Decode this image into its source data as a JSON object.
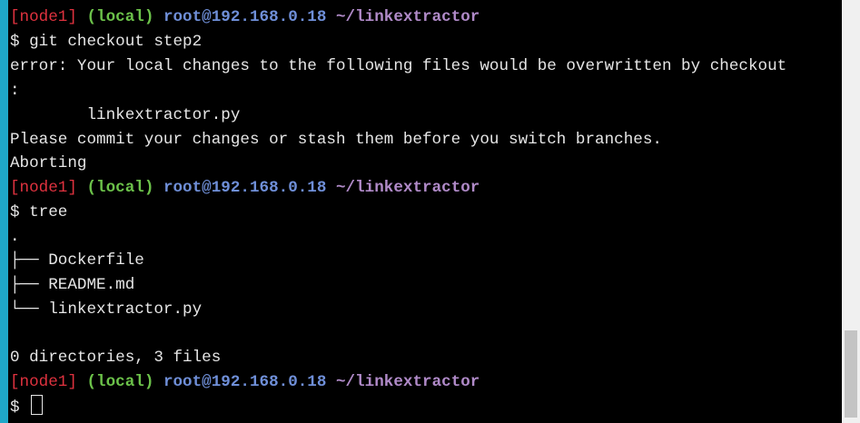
{
  "prompt_1": {
    "node": "[node1]",
    "local": "(local)",
    "user": "root@192.168.0.18",
    "path": "~/linkextractor"
  },
  "cmd_1": "$ git checkout step2",
  "error_line_1": "error: Your local changes to the following files would be overwritten by checkout",
  "error_line_2": ":",
  "error_file": "        linkextractor.py",
  "please_commit": "Please commit your changes or stash them before you switch branches.",
  "aborting": "Aborting",
  "prompt_2": {
    "node": "[node1]",
    "local": "(local)",
    "user": "root@192.168.0.18",
    "path": "~/linkextractor"
  },
  "cmd_2": "$ tree",
  "tree": {
    "root": ".",
    "entries": [
      "├── Dockerfile",
      "├── README.md",
      "└── linkextractor.py"
    ],
    "summary": "0 directories, 3 files"
  },
  "prompt_3": {
    "node": "[node1]",
    "local": "(local)",
    "user": "root@192.168.0.18",
    "path": "~/linkextractor"
  },
  "cmd_3_prefix": "$ ",
  "colors": {
    "background": "#000000",
    "text": "#e6e6e6",
    "node": "#e0323f",
    "local": "#6cc24a",
    "user": "#6f8fd8",
    "path": "#b08ac8",
    "left_bar": "#1fa8c9",
    "scrollbar_track": "#f0f0f0",
    "scrollbar_thumb": "#c4c4c4"
  },
  "scroll_position": 0.78
}
